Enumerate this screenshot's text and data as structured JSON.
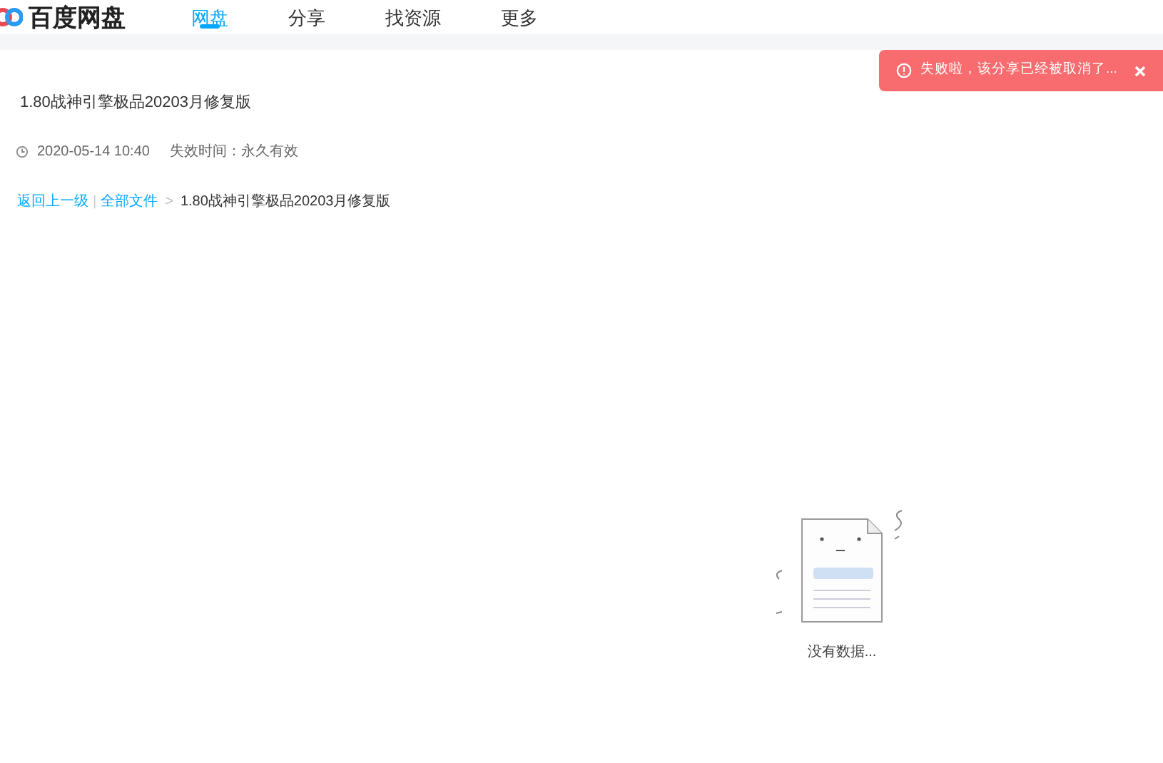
{
  "header": {
    "logo_text": "百度网盘",
    "nav": [
      {
        "label": "网盘",
        "selected": true
      },
      {
        "label": "分享",
        "selected": false
      },
      {
        "label": "找资源",
        "selected": false
      },
      {
        "label": "更多",
        "selected": false
      }
    ]
  },
  "toast": {
    "message": "失败啦，该分享已经被取消了..."
  },
  "share": {
    "title": "1.80战神引擎极品20203月修复版",
    "date": "2020-05-14 10:40",
    "expiry": "失效时间：永久有效"
  },
  "breadcrumb": {
    "back": "返回上一级",
    "separator": "|",
    "all_files": "全部文件",
    "arrow": ">",
    "current": "1.80战神引擎极品20203月修复版"
  },
  "empty": {
    "message": "没有数据..."
  }
}
